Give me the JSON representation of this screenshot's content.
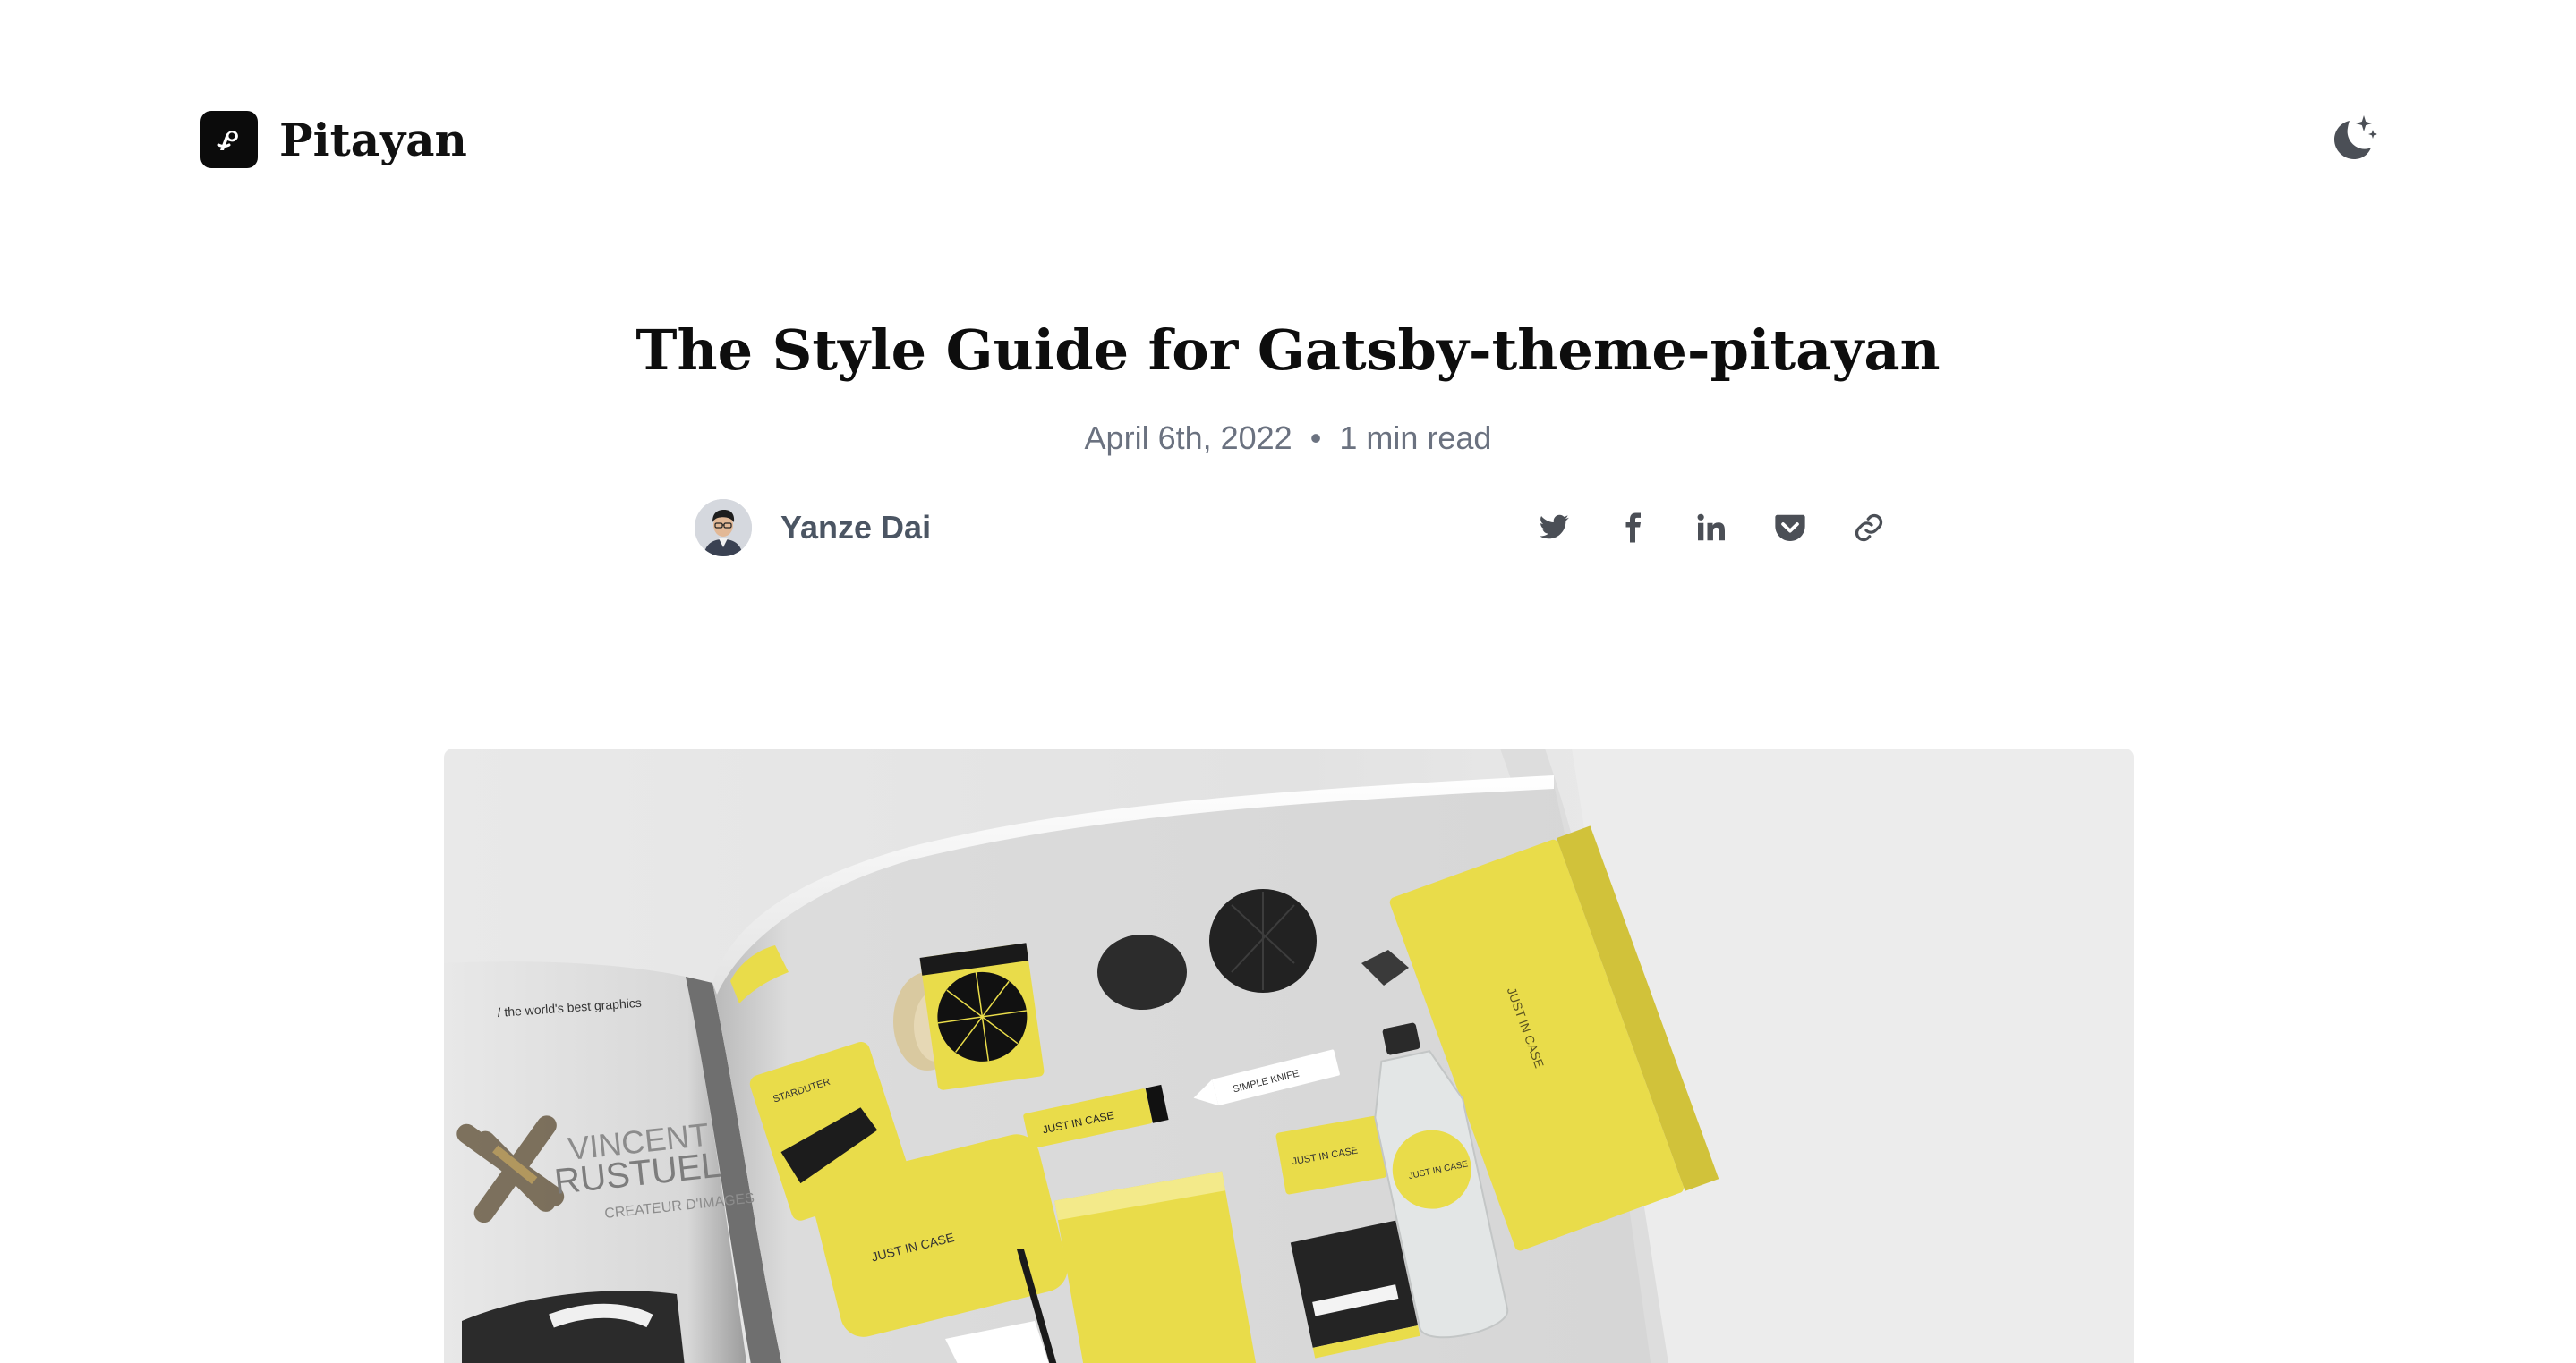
{
  "header": {
    "brand_name": "Pitayan",
    "logo_icon": "pitayan-logo-icon",
    "theme_toggle_icon": "moon-stars-icon"
  },
  "post": {
    "title": "The Style Guide for Gatsby-theme-pitayan",
    "date": "April 6th, 2022",
    "separator": "•",
    "read_time": "1 min read",
    "author": {
      "name": "Yanze Dai",
      "avatar_icon": "author-avatar"
    },
    "share": [
      {
        "icon": "twitter-icon"
      },
      {
        "icon": "facebook-icon"
      },
      {
        "icon": "linkedin-icon"
      },
      {
        "icon": "pocket-icon"
      },
      {
        "icon": "link-icon"
      }
    ],
    "hero": {
      "brand_texts": [
        "JUST IN CASE",
        "SIMPLE KNIFE",
        "VINCENT",
        "RUSTUEL",
        "CREATEUR D'IMAGES",
        "the world's best graphics"
      ],
      "accent_color": "#e9dc4a"
    }
  },
  "colors": {
    "text": "#0d0d0d",
    "muted": "#6b7280",
    "icon": "#4b5563"
  }
}
